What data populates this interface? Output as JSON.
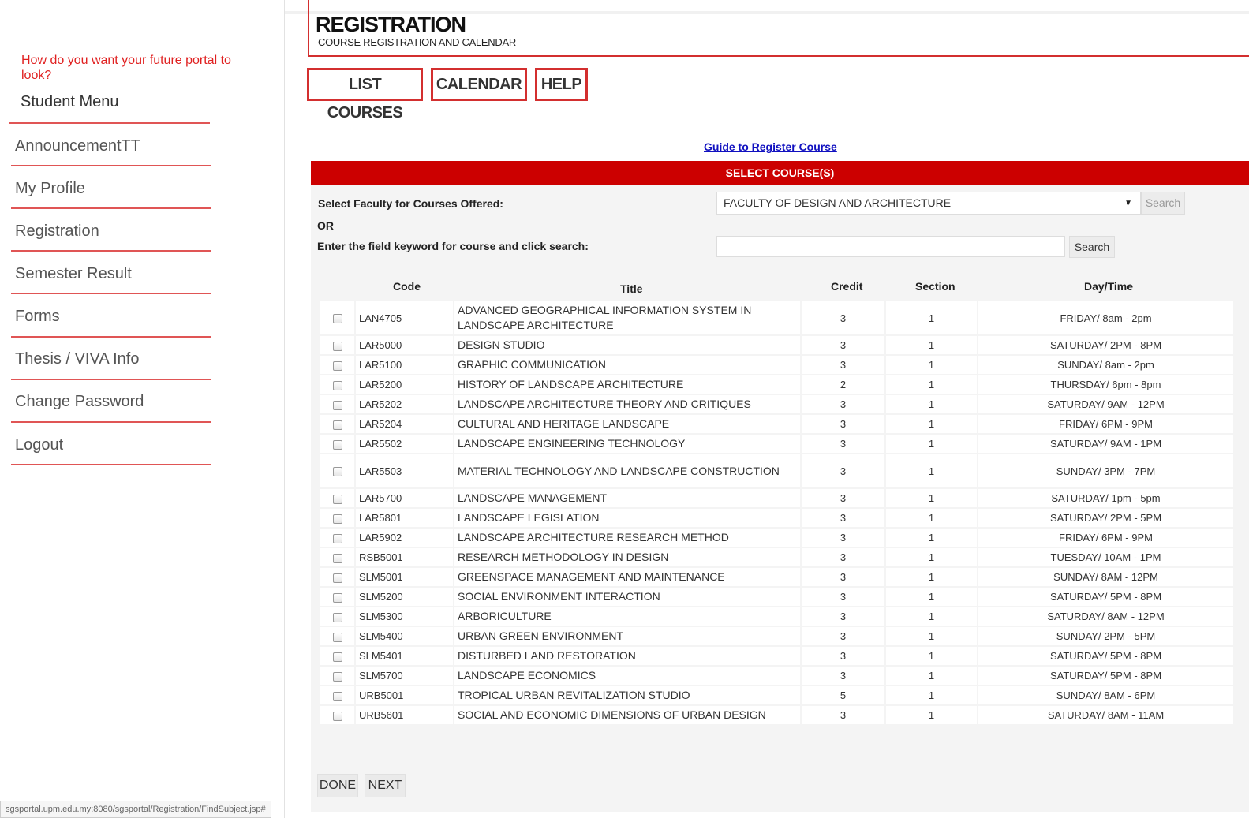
{
  "sidebar": {
    "survey_link": "How do you want your future portal to look?",
    "menu_title": "Student Menu",
    "items": [
      {
        "label": "AnnouncementTT"
      },
      {
        "label": "My Profile"
      },
      {
        "label": "Registration"
      },
      {
        "label": "Semester Result"
      },
      {
        "label": "Forms"
      },
      {
        "label": "Thesis / VIVA Info"
      },
      {
        "label": "Change Password"
      },
      {
        "label": "Logout"
      }
    ]
  },
  "header": {
    "title": "REGISTRATION",
    "subtitle": "COURSE REGISTRATION AND CALENDAR"
  },
  "tabs": [
    {
      "label": "LIST COURSES"
    },
    {
      "label": "CALENDAR"
    },
    {
      "label": "HELP"
    }
  ],
  "guide_link": "Guide to Register Course",
  "section_bar": "SELECT COURSE(S)",
  "search": {
    "faculty_label": "Select Faculty for Courses Offered:",
    "faculty_selected": "FACULTY OF DESIGN AND ARCHITECTURE",
    "search_button": "Search",
    "or_label": "OR",
    "keyword_label": "Enter the field keyword for course and click search:",
    "keyword_value": "",
    "keyword_button": "Search"
  },
  "table": {
    "headers": {
      "code": "Code",
      "title": "Title",
      "credit": "Credit",
      "section": "Section",
      "daytime": "Day/Time"
    },
    "rows": [
      {
        "code": "LAN4705",
        "title": "ADVANCED GEOGRAPHICAL INFORMATION SYSTEM IN LANDSCAPE ARCHITECTURE",
        "credit": "3",
        "section": "1",
        "daytime": "FRIDAY/ 8am - 2pm",
        "tall": true
      },
      {
        "code": "LAR5000",
        "title": "DESIGN STUDIO",
        "credit": "3",
        "section": "1",
        "daytime": "SATURDAY/ 2PM - 8PM"
      },
      {
        "code": "LAR5100",
        "title": "GRAPHIC COMMUNICATION",
        "credit": "3",
        "section": "1",
        "daytime": "SUNDAY/ 8am - 2pm"
      },
      {
        "code": "LAR5200",
        "title": "HISTORY OF LANDSCAPE ARCHITECTURE",
        "credit": "2",
        "section": "1",
        "daytime": "THURSDAY/ 6pm - 8pm"
      },
      {
        "code": "LAR5202",
        "title": "LANDSCAPE ARCHITECTURE THEORY AND CRITIQUES",
        "credit": "3",
        "section": "1",
        "daytime": "SATURDAY/ 9AM - 12PM"
      },
      {
        "code": "LAR5204",
        "title": "CULTURAL AND HERITAGE LANDSCAPE",
        "credit": "3",
        "section": "1",
        "daytime": "FRIDAY/ 6PM - 9PM"
      },
      {
        "code": "LAR5502",
        "title": "LANDSCAPE ENGINEERING TECHNOLOGY",
        "credit": "3",
        "section": "1",
        "daytime": "SATURDAY/ 9AM - 1PM"
      },
      {
        "code": "LAR5503",
        "title": "MATERIAL TECHNOLOGY AND LANDSCAPE CONSTRUCTION",
        "credit": "3",
        "section": "1",
        "daytime": "SUNDAY/ 3PM - 7PM",
        "tall": true
      },
      {
        "code": "LAR5700",
        "title": "LANDSCAPE MANAGEMENT",
        "credit": "3",
        "section": "1",
        "daytime": "SATURDAY/ 1pm - 5pm"
      },
      {
        "code": "LAR5801",
        "title": "LANDSCAPE LEGISLATION",
        "credit": "3",
        "section": "1",
        "daytime": "SATURDAY/ 2PM - 5PM"
      },
      {
        "code": "LAR5902",
        "title": "LANDSCAPE ARCHITECTURE RESEARCH METHOD",
        "credit": "3",
        "section": "1",
        "daytime": "FRIDAY/ 6PM - 9PM"
      },
      {
        "code": "RSB5001",
        "title": "RESEARCH METHODOLOGY IN DESIGN",
        "credit": "3",
        "section": "1",
        "daytime": "TUESDAY/ 10AM - 1PM"
      },
      {
        "code": "SLM5001",
        "title": "GREENSPACE MANAGEMENT AND MAINTENANCE",
        "credit": "3",
        "section": "1",
        "daytime": "SUNDAY/ 8AM - 12PM"
      },
      {
        "code": "SLM5200",
        "title": "SOCIAL ENVIRONMENT INTERACTION",
        "credit": "3",
        "section": "1",
        "daytime": "SATURDAY/ 5PM - 8PM"
      },
      {
        "code": "SLM5300",
        "title": "ARBORICULTURE",
        "credit": "3",
        "section": "1",
        "daytime": "SATURDAY/ 8AM - 12PM"
      },
      {
        "code": "SLM5400",
        "title": "URBAN GREEN ENVIRONMENT",
        "credit": "3",
        "section": "1",
        "daytime": "SUNDAY/ 2PM - 5PM"
      },
      {
        "code": "SLM5401",
        "title": "DISTURBED LAND RESTORATION",
        "credit": "3",
        "section": "1",
        "daytime": "SATURDAY/ 5PM - 8PM"
      },
      {
        "code": "SLM5700",
        "title": "LANDSCAPE ECONOMICS",
        "credit": "3",
        "section": "1",
        "daytime": "SATURDAY/ 5PM - 8PM"
      },
      {
        "code": "URB5001",
        "title": "TROPICAL URBAN REVITALIZATION STUDIO",
        "credit": "5",
        "section": "1",
        "daytime": "SUNDAY/ 8AM - 6PM"
      },
      {
        "code": "URB5601",
        "title": "SOCIAL AND ECONOMIC DIMENSIONS OF URBAN DESIGN",
        "credit": "3",
        "section": "1",
        "daytime": "SATURDAY/ 8AM - 11AM"
      }
    ]
  },
  "footer": {
    "done": "DONE",
    "next": "NEXT"
  },
  "statusbar": "sgsportal.upm.edu.my:8080/sgsportal/Registration/FindSubject.jsp#",
  "colors": {
    "accent": "#cc0000",
    "link": "#1010c0"
  }
}
